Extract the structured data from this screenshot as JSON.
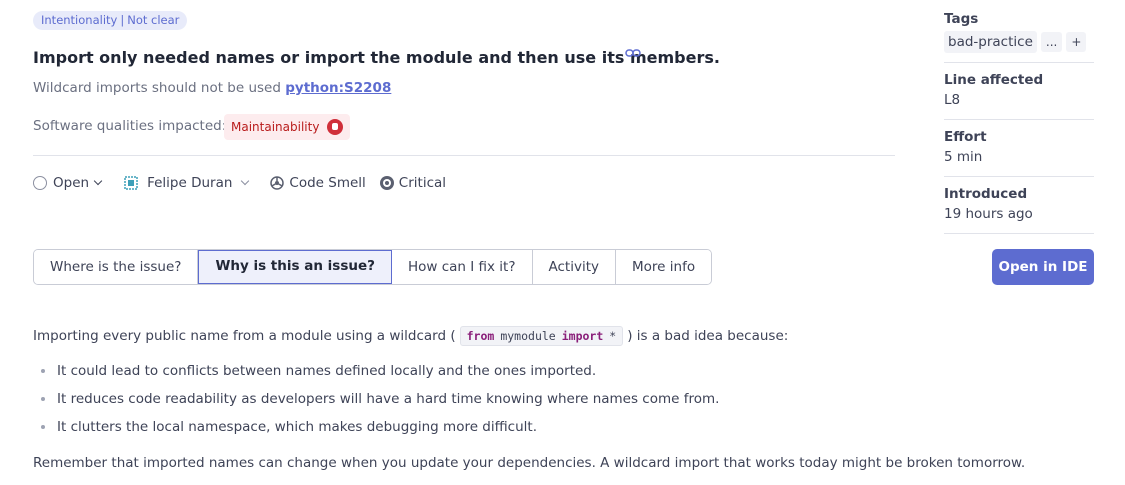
{
  "header": {
    "attribute_category": "Intentionality",
    "attribute_value": "Not clear",
    "title": "Import only needed names or import the module and then use its members.",
    "rule_text": "Wildcard imports should not be used",
    "rule_key": "python:S2208",
    "qualities_label": "Software qualities impacted:",
    "quality": "Maintainability"
  },
  "meta": {
    "status": "Open",
    "assignee": "Felipe Duran",
    "type": "Code Smell",
    "severity": "Critical"
  },
  "tabs": [
    {
      "label": "Where is the issue?",
      "active": false
    },
    {
      "label": "Why is this an issue?",
      "active": true
    },
    {
      "label": "How can I fix it?",
      "active": false
    },
    {
      "label": "Activity",
      "active": false
    },
    {
      "label": "More info",
      "active": false
    }
  ],
  "content": {
    "intro_before": "Importing every public name from a module using a wildcard (",
    "code_from": "from",
    "code_module": "mymodule",
    "code_import": "import",
    "code_star": "*",
    "intro_after": ") is a bad idea because:",
    "bullets": [
      "It could lead to conflicts between names defined locally and the ones imported.",
      "It reduces code readability as developers will have a hard time knowing where names come from.",
      "It clutters the local namespace, which makes debugging more difficult."
    ],
    "footer": "Remember that imported names can change when you update your dependencies. A wildcard import that works today might be broken tomorrow."
  },
  "sidebar": {
    "tags_label": "Tags",
    "tag": "bad-practice",
    "more_tags": "...",
    "add_tag": "+",
    "line_label": "Line affected",
    "line_value": "L8",
    "effort_label": "Effort",
    "effort_value": "5 min",
    "introduced_label": "Introduced",
    "introduced_value": "19 hours ago",
    "ide_button": "Open in IDE"
  },
  "colors": {
    "accent": "#5d6cd0",
    "critical_badge": "#d02f3a"
  }
}
